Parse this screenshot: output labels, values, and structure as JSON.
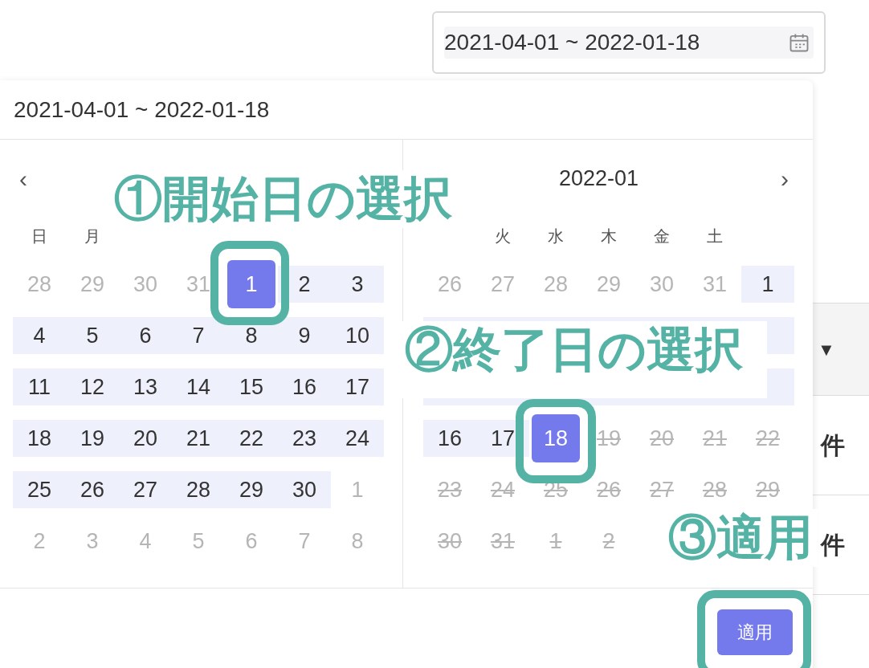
{
  "range_field": {
    "value": "2021-04-01 ~ 2022-01-18"
  },
  "popover": {
    "value": "2021-04-01 ~ 2022-01-18",
    "panels": [
      {
        "kind": "start",
        "nav": "‹",
        "weekdays": [
          "日",
          "月"
        ],
        "weeks": [
          {
            "kind": "dates",
            "days": [
              {
                "d": "28",
                "kind": "outside"
              },
              {
                "d": "29",
                "kind": "outside"
              },
              {
                "d": "30",
                "kind": "outside"
              },
              {
                "d": "31",
                "kind": "outside"
              },
              {
                "d": "1",
                "kind": "selected"
              },
              {
                "d": "2",
                "kind": "range"
              },
              {
                "d": "3",
                "kind": "range"
              }
            ]
          },
          {
            "kind": "dates",
            "days": [
              {
                "d": "4",
                "kind": "range"
              },
              {
                "d": "5",
                "kind": "range"
              },
              {
                "d": "6",
                "kind": "range"
              },
              {
                "d": "7",
                "kind": "range"
              },
              {
                "d": "8",
                "kind": "range"
              },
              {
                "d": "9",
                "kind": "range"
              },
              {
                "d": "10",
                "kind": "range"
              }
            ]
          },
          {
            "kind": "dates",
            "days": [
              {
                "d": "11",
                "kind": "range"
              },
              {
                "d": "12",
                "kind": "range"
              },
              {
                "d": "13",
                "kind": "range"
              },
              {
                "d": "14",
                "kind": "range"
              },
              {
                "d": "15",
                "kind": "range"
              },
              {
                "d": "16",
                "kind": "range"
              },
              {
                "d": "17",
                "kind": "range"
              }
            ]
          },
          {
            "kind": "dates",
            "days": [
              {
                "d": "18",
                "kind": "range"
              },
              {
                "d": "19",
                "kind": "range"
              },
              {
                "d": "20",
                "kind": "range"
              },
              {
                "d": "21",
                "kind": "range"
              },
              {
                "d": "22",
                "kind": "range"
              },
              {
                "d": "23",
                "kind": "range"
              },
              {
                "d": "24",
                "kind": "range"
              }
            ]
          },
          {
            "kind": "dates",
            "days": [
              {
                "d": "25",
                "kind": "range"
              },
              {
                "d": "26",
                "kind": "range"
              },
              {
                "d": "27",
                "kind": "range"
              },
              {
                "d": "28",
                "kind": "range"
              },
              {
                "d": "29",
                "kind": "range"
              },
              {
                "d": "30",
                "kind": "range"
              },
              {
                "d": "1",
                "kind": "outside"
              }
            ]
          },
          {
            "kind": "dates",
            "days": [
              {
                "d": "2",
                "kind": "outside"
              },
              {
                "d": "3",
                "kind": "outside"
              },
              {
                "d": "4",
                "kind": "outside"
              },
              {
                "d": "5",
                "kind": "outside"
              },
              {
                "d": "6",
                "kind": "outside"
              },
              {
                "d": "7",
                "kind": "outside"
              },
              {
                "d": "8",
                "kind": "outside"
              }
            ]
          }
        ]
      },
      {
        "kind": "end",
        "title": "2022-01",
        "nav": "›",
        "weekdays": [
          "火",
          "水",
          "木",
          "金",
          "土"
        ],
        "weeks": [
          {
            "kind": "dates",
            "days": [
              {
                "d": "26",
                "kind": "outside"
              },
              {
                "d": "27",
                "kind": "outside"
              },
              {
                "d": "28",
                "kind": "outside"
              },
              {
                "d": "29",
                "kind": "outside"
              },
              {
                "d": "30",
                "kind": "outside"
              },
              {
                "d": "31",
                "kind": "outside"
              },
              {
                "d": "1",
                "kind": "range"
              }
            ]
          },
          {
            "kind": "covered"
          },
          {
            "kind": "covered"
          },
          {
            "kind": "dates",
            "days": [
              {
                "d": "16",
                "kind": "range"
              },
              {
                "d": "17",
                "kind": "range"
              },
              {
                "d": "18",
                "kind": "selected"
              },
              {
                "d": "19",
                "kind": "disabled"
              },
              {
                "d": "20",
                "kind": "disabled"
              },
              {
                "d": "21",
                "kind": "disabled"
              },
              {
                "d": "22",
                "kind": "disabled"
              }
            ]
          },
          {
            "kind": "dates",
            "days": [
              {
                "d": "23",
                "kind": "disabled"
              },
              {
                "d": "24",
                "kind": "disabled"
              },
              {
                "d": "25",
                "kind": "disabled"
              },
              {
                "d": "26",
                "kind": "disabled"
              },
              {
                "d": "27",
                "kind": "disabled"
              },
              {
                "d": "28",
                "kind": "disabled"
              },
              {
                "d": "29",
                "kind": "disabled"
              }
            ]
          },
          {
            "kind": "dates",
            "days": [
              {
                "d": "30",
                "kind": "disabled"
              },
              {
                "d": "31",
                "kind": "disabled"
              },
              {
                "d": "1",
                "kind": "disabled"
              },
              {
                "d": "2",
                "kind": "disabled"
              }
            ]
          }
        ]
      }
    ],
    "apply_button": "適用"
  },
  "background": {
    "caret": "▼",
    "labels": [
      "件",
      "件"
    ]
  },
  "annotations": [
    "①開始日の選択",
    "②終了日の選択",
    "③適用"
  ]
}
